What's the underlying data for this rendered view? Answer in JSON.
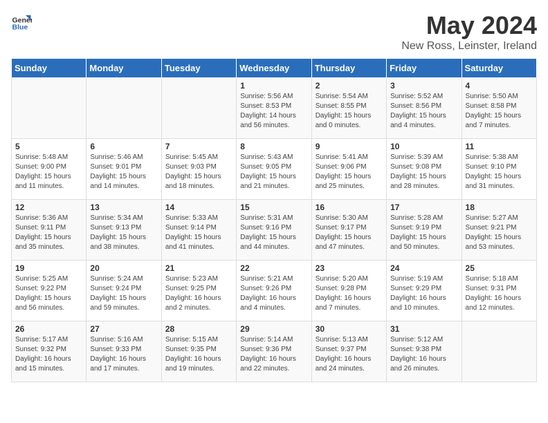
{
  "logo": {
    "general": "General",
    "blue": "Blue"
  },
  "title": "May 2024",
  "location": "New Ross, Leinster, Ireland",
  "weekdays": [
    "Sunday",
    "Monday",
    "Tuesday",
    "Wednesday",
    "Thursday",
    "Friday",
    "Saturday"
  ],
  "weeks": [
    [
      {
        "day": "",
        "info": ""
      },
      {
        "day": "",
        "info": ""
      },
      {
        "day": "",
        "info": ""
      },
      {
        "day": "1",
        "info": "Sunrise: 5:56 AM\nSunset: 8:53 PM\nDaylight: 14 hours\nand 56 minutes."
      },
      {
        "day": "2",
        "info": "Sunrise: 5:54 AM\nSunset: 8:55 PM\nDaylight: 15 hours\nand 0 minutes."
      },
      {
        "day": "3",
        "info": "Sunrise: 5:52 AM\nSunset: 8:56 PM\nDaylight: 15 hours\nand 4 minutes."
      },
      {
        "day": "4",
        "info": "Sunrise: 5:50 AM\nSunset: 8:58 PM\nDaylight: 15 hours\nand 7 minutes."
      }
    ],
    [
      {
        "day": "5",
        "info": "Sunrise: 5:48 AM\nSunset: 9:00 PM\nDaylight: 15 hours\nand 11 minutes."
      },
      {
        "day": "6",
        "info": "Sunrise: 5:46 AM\nSunset: 9:01 PM\nDaylight: 15 hours\nand 14 minutes."
      },
      {
        "day": "7",
        "info": "Sunrise: 5:45 AM\nSunset: 9:03 PM\nDaylight: 15 hours\nand 18 minutes."
      },
      {
        "day": "8",
        "info": "Sunrise: 5:43 AM\nSunset: 9:05 PM\nDaylight: 15 hours\nand 21 minutes."
      },
      {
        "day": "9",
        "info": "Sunrise: 5:41 AM\nSunset: 9:06 PM\nDaylight: 15 hours\nand 25 minutes."
      },
      {
        "day": "10",
        "info": "Sunrise: 5:39 AM\nSunset: 9:08 PM\nDaylight: 15 hours\nand 28 minutes."
      },
      {
        "day": "11",
        "info": "Sunrise: 5:38 AM\nSunset: 9:10 PM\nDaylight: 15 hours\nand 31 minutes."
      }
    ],
    [
      {
        "day": "12",
        "info": "Sunrise: 5:36 AM\nSunset: 9:11 PM\nDaylight: 15 hours\nand 35 minutes."
      },
      {
        "day": "13",
        "info": "Sunrise: 5:34 AM\nSunset: 9:13 PM\nDaylight: 15 hours\nand 38 minutes."
      },
      {
        "day": "14",
        "info": "Sunrise: 5:33 AM\nSunset: 9:14 PM\nDaylight: 15 hours\nand 41 minutes."
      },
      {
        "day": "15",
        "info": "Sunrise: 5:31 AM\nSunset: 9:16 PM\nDaylight: 15 hours\nand 44 minutes."
      },
      {
        "day": "16",
        "info": "Sunrise: 5:30 AM\nSunset: 9:17 PM\nDaylight: 15 hours\nand 47 minutes."
      },
      {
        "day": "17",
        "info": "Sunrise: 5:28 AM\nSunset: 9:19 PM\nDaylight: 15 hours\nand 50 minutes."
      },
      {
        "day": "18",
        "info": "Sunrise: 5:27 AM\nSunset: 9:21 PM\nDaylight: 15 hours\nand 53 minutes."
      }
    ],
    [
      {
        "day": "19",
        "info": "Sunrise: 5:25 AM\nSunset: 9:22 PM\nDaylight: 15 hours\nand 56 minutes."
      },
      {
        "day": "20",
        "info": "Sunrise: 5:24 AM\nSunset: 9:24 PM\nDaylight: 15 hours\nand 59 minutes."
      },
      {
        "day": "21",
        "info": "Sunrise: 5:23 AM\nSunset: 9:25 PM\nDaylight: 16 hours\nand 2 minutes."
      },
      {
        "day": "22",
        "info": "Sunrise: 5:21 AM\nSunset: 9:26 PM\nDaylight: 16 hours\nand 4 minutes."
      },
      {
        "day": "23",
        "info": "Sunrise: 5:20 AM\nSunset: 9:28 PM\nDaylight: 16 hours\nand 7 minutes."
      },
      {
        "day": "24",
        "info": "Sunrise: 5:19 AM\nSunset: 9:29 PM\nDaylight: 16 hours\nand 10 minutes."
      },
      {
        "day": "25",
        "info": "Sunrise: 5:18 AM\nSunset: 9:31 PM\nDaylight: 16 hours\nand 12 minutes."
      }
    ],
    [
      {
        "day": "26",
        "info": "Sunrise: 5:17 AM\nSunset: 9:32 PM\nDaylight: 16 hours\nand 15 minutes."
      },
      {
        "day": "27",
        "info": "Sunrise: 5:16 AM\nSunset: 9:33 PM\nDaylight: 16 hours\nand 17 minutes."
      },
      {
        "day": "28",
        "info": "Sunrise: 5:15 AM\nSunset: 9:35 PM\nDaylight: 16 hours\nand 19 minutes."
      },
      {
        "day": "29",
        "info": "Sunrise: 5:14 AM\nSunset: 9:36 PM\nDaylight: 16 hours\nand 22 minutes."
      },
      {
        "day": "30",
        "info": "Sunrise: 5:13 AM\nSunset: 9:37 PM\nDaylight: 16 hours\nand 24 minutes."
      },
      {
        "day": "31",
        "info": "Sunrise: 5:12 AM\nSunset: 9:38 PM\nDaylight: 16 hours\nand 26 minutes."
      },
      {
        "day": "",
        "info": ""
      }
    ]
  ]
}
